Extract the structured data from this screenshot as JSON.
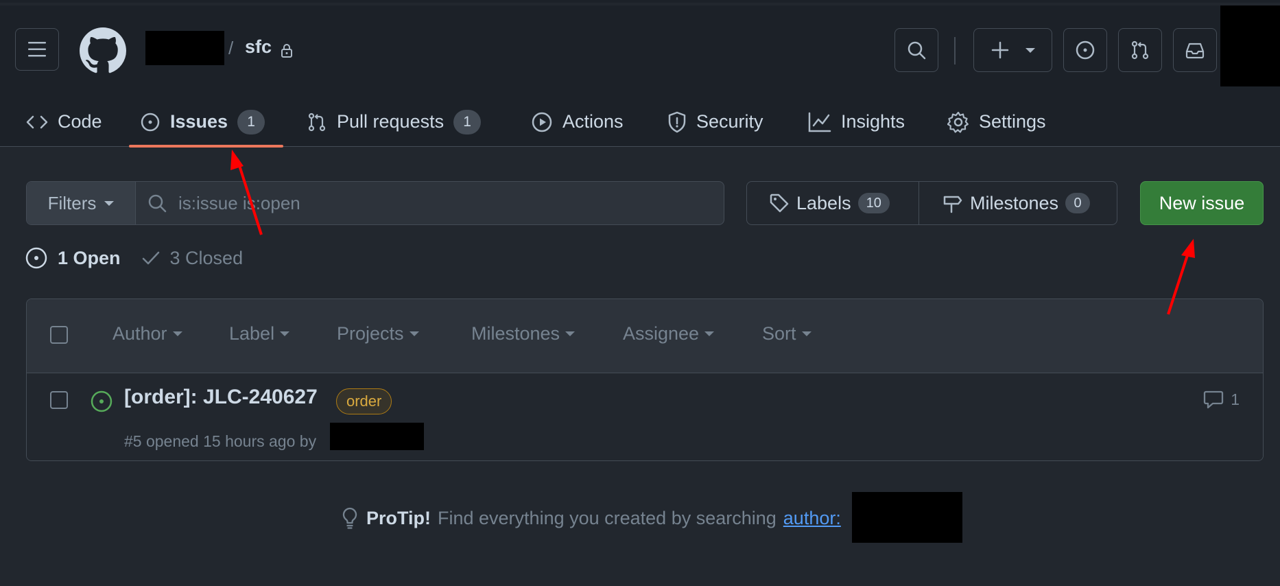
{
  "repo": {
    "name": "sfc"
  },
  "tabs": [
    {
      "label": "Code",
      "icon": "code-icon"
    },
    {
      "label": "Issues",
      "count": "1",
      "icon": "issue-opened-icon"
    },
    {
      "label": "Pull requests",
      "count": "1",
      "icon": "git-pull-request-icon"
    },
    {
      "label": "Actions",
      "icon": "play-icon"
    },
    {
      "label": "Security",
      "icon": "shield-icon"
    },
    {
      "label": "Insights",
      "icon": "graph-icon"
    },
    {
      "label": "Settings",
      "icon": "gear-icon"
    }
  ],
  "filters": {
    "button_label": "Filters",
    "search_placeholder": "is:issue is:open"
  },
  "labels": {
    "label": "Labels",
    "count": "10"
  },
  "milestones": {
    "label": "Milestones",
    "count": "0"
  },
  "new_issue_label": "New issue",
  "states": {
    "open": "1 Open",
    "closed": "3 Closed"
  },
  "table_header": [
    "Author",
    "Label",
    "Projects",
    "Milestones",
    "Assignee",
    "Sort"
  ],
  "issues": [
    {
      "title": "[order]: JLC-240627",
      "label": "order",
      "meta": "#5 opened 15 hours ago by",
      "comments": "1"
    }
  ],
  "protip": {
    "strong": "ProTip!",
    "text": "Find everything you created by searching",
    "link": "author:"
  },
  "colors": {
    "accent_underline": "#ec775c",
    "new_issue_bg": "#347d39",
    "open_icon": "#57ab5a",
    "label_order": "#daaa3f",
    "annotation_arrow": "#ff0000"
  }
}
